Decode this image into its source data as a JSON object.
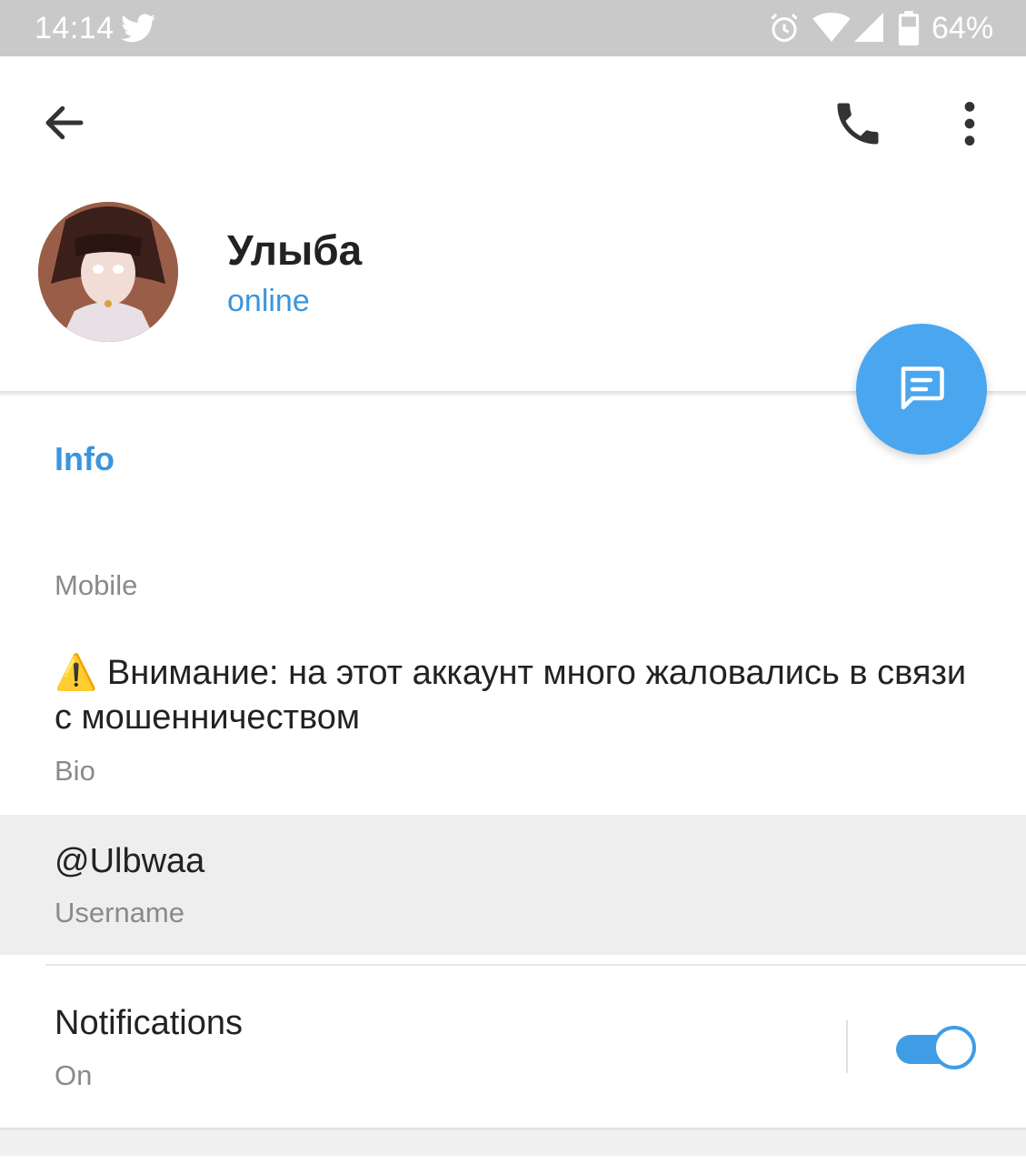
{
  "status_bar": {
    "time": "14:14",
    "battery": "64%",
    "icons": [
      "twitter-icon",
      "alarm-icon",
      "wifi-icon",
      "signal-icon",
      "battery-icon"
    ]
  },
  "toolbar": {
    "icons": [
      "back-arrow-icon",
      "phone-icon",
      "more-vert-icon"
    ]
  },
  "profile": {
    "name": "Улыба",
    "status": "online"
  },
  "fab": {
    "icon": "message-icon"
  },
  "info": {
    "section_title": "Info",
    "phone_label": "Mobile",
    "bio": "⚠️ Внимание: на этот аккаунт много жаловались в связи с мошенничеством",
    "bio_label": "Bio",
    "username": "@Ulbwaa",
    "username_label": "Username",
    "notifications_title": "Notifications",
    "notifications_value": "On",
    "notifications_enabled": true
  },
  "colors": {
    "accent": "#3a95dd",
    "fab": "#4aa6ef",
    "status_bar": "#c9c9c9",
    "secondary_text": "#8a8a8a"
  }
}
